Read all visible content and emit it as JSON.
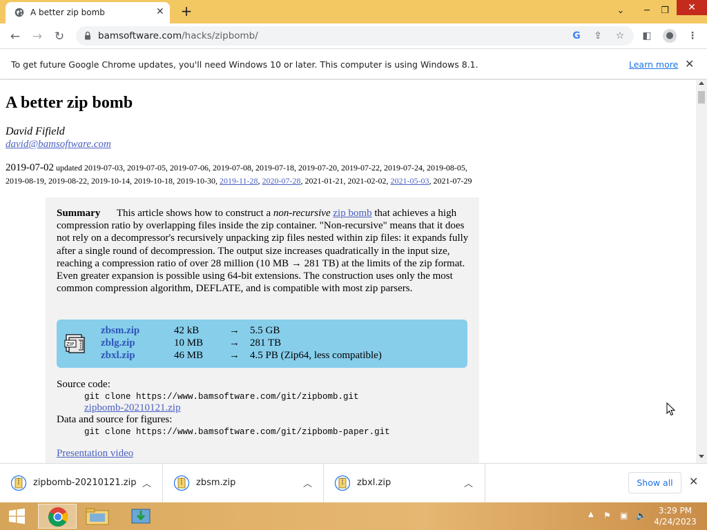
{
  "browser": {
    "tab_title": "A better zip bomb",
    "tab_close": "✕",
    "new_tab": "+",
    "url_host": "bamsoftware.com",
    "url_path": "/hacks/zipbomb/"
  },
  "infobar": {
    "message": "To get future Google Chrome updates, you'll need Windows 10 or later. This computer is using Windows 8.1.",
    "learn_more": "Learn more",
    "close": "✕"
  },
  "article": {
    "title": "A better zip bomb",
    "author": "David Fifield",
    "email": "david@bamsoftware.com",
    "date_main": "2019-07-02",
    "updated_label": "updated",
    "dates_line1": "2019-07-03, 2019-07-05, 2019-07-06, 2019-07-08, 2019-07-18, 2019-07-20, 2019-07-22, 2019-07-24, 2019-08-05,",
    "dates_line2a": "2019-08-19, 2019-08-22, 2019-10-14, 2019-10-18, 2019-10-30,",
    "date_link1": "2019-11-28",
    "date_link2": "2020-07-28",
    "dates_line2b": ", 2021-01-21, 2021-02-02,",
    "date_link3": "2021-05-03",
    "dates_line2c": ", 2021-07-29"
  },
  "summary": {
    "label": "Summary",
    "text1": "This article shows how to construct a",
    "em": "non-recursive",
    "link": "zip bomb",
    "text2": "that achieves a high compression ratio by overlapping files inside the zip container. \"Non-recursive\" means that it does not rely on a decompressor's recursively unpacking zip files nested within zip files: it expands fully after a single round of decompression. The output size increases quadratically in the input size, reaching a compression ratio of over 28 million (10 MB → 281 TB) at the limits of the zip format. Even greater expansion is possible using 64-bit extensions. The construction uses only the most common compression algorithm, DEFLATE, and is compatible with most zip parsers."
  },
  "files": [
    {
      "name": "zbsm.zip",
      "size": "42 kB",
      "arrow": "→",
      "result": "5.5 GB"
    },
    {
      "name": "zblg.zip",
      "size": "10 MB",
      "arrow": "→",
      "result": "281 TB"
    },
    {
      "name": "zbxl.zip",
      "size": "46 MB",
      "arrow": "→",
      "result": "4.5 PB (Zip64, less compatible)"
    }
  ],
  "source": {
    "label": "Source code:",
    "git1": "git clone https://www.bamsoftware.com/git/zipbomb.git",
    "zip_link": "zipbomb-20210121.zip",
    "data_label": "Data and source for figures:",
    "git2": "git clone https://www.bamsoftware.com/git/zipbomb-paper.git",
    "video": "Presentation video"
  },
  "downloads": {
    "items": [
      {
        "name": "zipbomb-20210121.zip"
      },
      {
        "name": "zbsm.zip"
      },
      {
        "name": "zbxl.zip"
      }
    ],
    "show_all": "Show all",
    "close": "✕"
  },
  "taskbar": {
    "time": "3:29 PM",
    "date": "4/24/2023"
  },
  "colors": {
    "tabbar": "#f3c762",
    "link": "#4a5fc1",
    "file_box": "#87ceeb",
    "summary_bg": "#f2f2f2"
  }
}
